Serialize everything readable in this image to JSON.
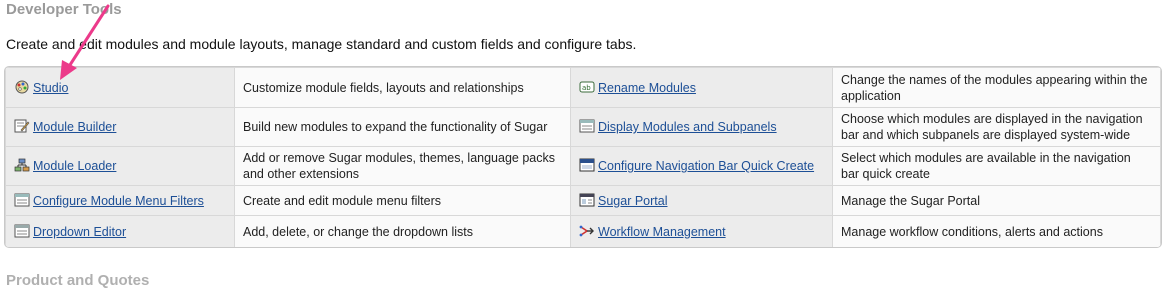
{
  "section": {
    "title": "Developer Tools",
    "description": "Create and edit modules and module layouts, manage standard and custom fields and configure tabs."
  },
  "tools": [
    {
      "left": {
        "label": "Studio",
        "icon": "studio-icon",
        "desc": "Customize module fields, layouts and relationships"
      },
      "right": {
        "label": "Rename Modules",
        "icon": "rename-icon",
        "desc": "Change the names of the modules appearing within the application"
      }
    },
    {
      "left": {
        "label": "Module Builder",
        "icon": "module-builder-icon",
        "desc": "Build new modules to expand the functionality of Sugar"
      },
      "right": {
        "label": "Display Modules and Subpanels",
        "icon": "display-modules-icon",
        "desc": "Choose which modules are displayed in the navigation bar and which subpanels are displayed system-wide"
      }
    },
    {
      "left": {
        "label": "Module Loader",
        "icon": "module-loader-icon",
        "desc": "Add or remove Sugar modules, themes, language packs and other extensions"
      },
      "right": {
        "label": "Configure Navigation Bar Quick Create",
        "icon": "quick-create-icon",
        "desc": "Select which modules are available in the navigation bar quick create"
      }
    },
    {
      "left": {
        "label": "Configure Module Menu Filters",
        "icon": "menu-filters-icon",
        "desc": "Create and edit module menu filters"
      },
      "right": {
        "label": "Sugar Portal",
        "icon": "portal-icon",
        "desc": "Manage the Sugar Portal"
      }
    },
    {
      "left": {
        "label": "Dropdown Editor",
        "icon": "dropdown-editor-icon",
        "desc": "Add, delete, or change the dropdown lists"
      },
      "right": {
        "label": "Workflow Management",
        "icon": "workflow-icon",
        "desc": "Manage workflow conditions, alerts and actions"
      }
    }
  ],
  "next_section": {
    "title": "Product and Quotes"
  },
  "colors": {
    "link": "#1d4f96",
    "annotation_arrow": "#ec3a8a"
  }
}
